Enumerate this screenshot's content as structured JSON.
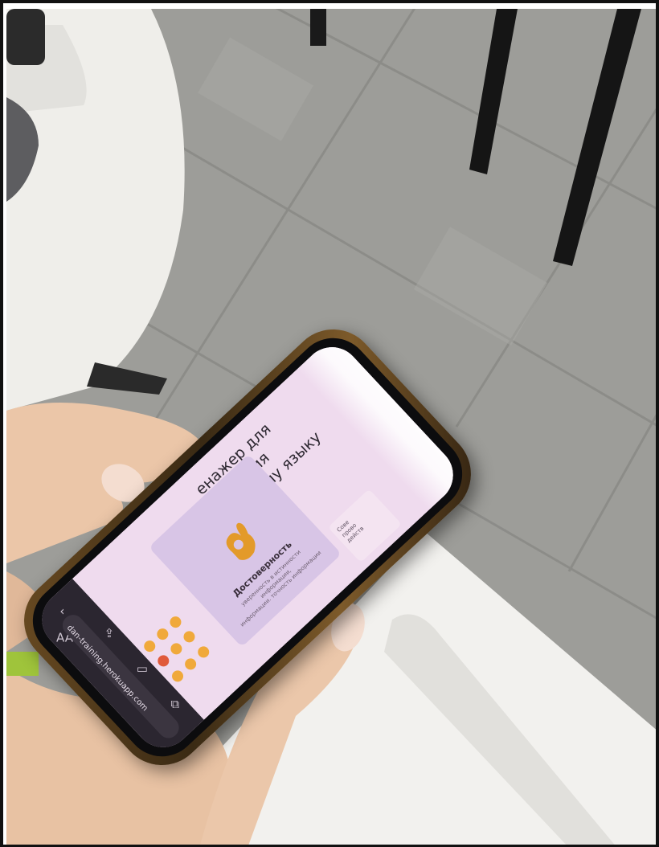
{
  "scene": {
    "description_kind": "photo",
    "floor_color": "#9c9c98",
    "table_color": "#f2f1ee"
  },
  "phone": {
    "browser": {
      "url": "dan-training.herokuapp.com",
      "aa_label": "AA"
    },
    "page": {
      "heading_line1": "енажер для обучения",
      "heading_line2": "русскому языку",
      "card": {
        "title": "Достоверность",
        "text_line1": "уверенность в истинности информации,",
        "text_line2": "информации. точность информации"
      },
      "side_card_text_1": "Сове",
      "side_card_text_2": "прово",
      "side_card_text_3": "действ"
    }
  }
}
